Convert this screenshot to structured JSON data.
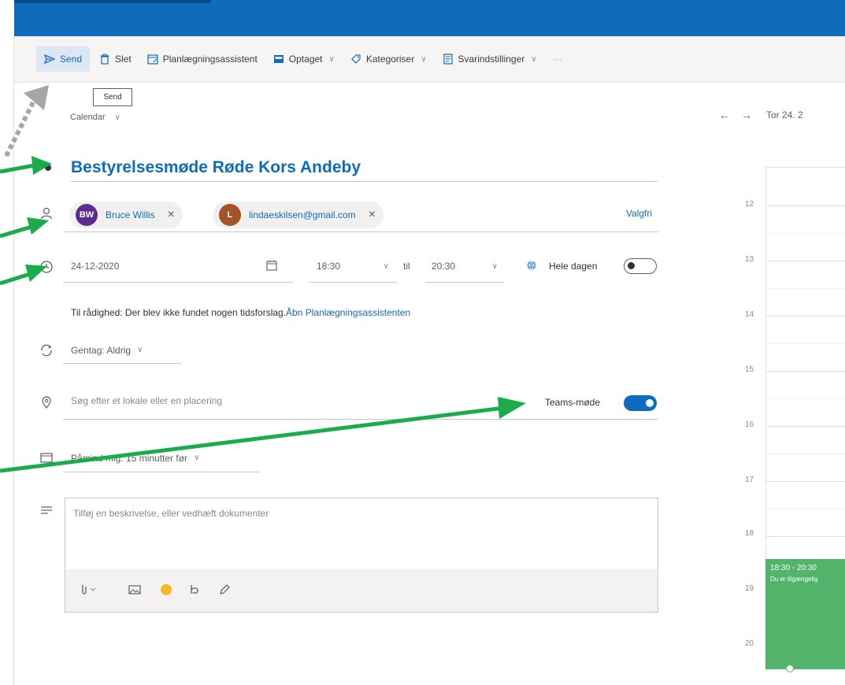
{
  "toolbar": {
    "send": "Send",
    "delete": "Slet",
    "scheduling": "Planlægningsassistent",
    "busy": "Optaget",
    "categorize": "Kategoriser",
    "response": "Svarindstillinger",
    "more": "···"
  },
  "tooltip": "Send",
  "calendar_label": "Calendar",
  "event": {
    "title": "Bestyrelsesmøde Røde Kors Andeby",
    "attendees": [
      {
        "initials": "BW",
        "name": "Bruce Willis",
        "color": "#5c2d91"
      },
      {
        "initials": "L",
        "name": "lindaeskilsen@gmail.com",
        "color": "#a4532a"
      }
    ],
    "optional": "Valgfri",
    "date": "24-12-2020",
    "start": "18:30",
    "to": "til",
    "end": "20:30",
    "all_day": "Hele dagen",
    "availability_prefix": "Til rådighed:  Der blev ikke fundet nogen tidsforslag.",
    "availability_link": "Åbn Planlægningsassistenten",
    "repeat": "Gentag: Aldrig",
    "location_placeholder": "Søg efter et lokale eller en placering",
    "teams": "Teams-møde",
    "reminder": "Påmind mig: 15 minutter før",
    "description_placeholder": "Tilføj en beskrivelse, eller vedhæft dokumenter"
  },
  "calendar": {
    "date_label": "Tor 24. 2",
    "hours": [
      "12",
      "13",
      "14",
      "15",
      "16",
      "17",
      "18",
      "19",
      "20"
    ],
    "event_time": "18:30 - 20:30",
    "event_sub": "Du er tilgængelig"
  },
  "colors": {
    "accent": "#0f6cbd",
    "annotation_arrow": "#1aab4b",
    "annotation_arrow_grey": "#a6a6a6",
    "event_fill": "#52b46a"
  }
}
